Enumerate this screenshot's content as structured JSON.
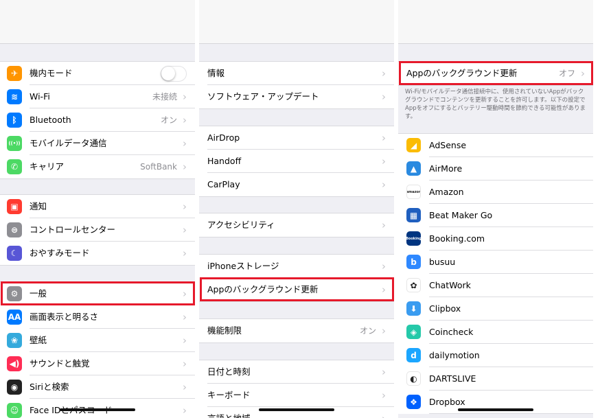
{
  "panel1": {
    "group1": [
      {
        "label": "機内モード",
        "icon": "airplane-icon",
        "color": "#ff9500",
        "glyph": "✈",
        "toggle": true
      },
      {
        "label": "Wi-Fi",
        "icon": "wifi-icon",
        "color": "#007aff",
        "glyph": "≋",
        "value": "未接続"
      },
      {
        "label": "Bluetooth",
        "icon": "bluetooth-icon",
        "color": "#007aff",
        "glyph": "ᛒ",
        "value": "オン"
      },
      {
        "label": "モバイルデータ通信",
        "icon": "antenna-icon",
        "color": "#4cd964",
        "glyph": "((•))"
      },
      {
        "label": "キャリア",
        "icon": "phone-icon",
        "color": "#4cd964",
        "glyph": "✆",
        "value": "SoftBank"
      }
    ],
    "group2": [
      {
        "label": "通知",
        "icon": "notifications-icon",
        "color": "#ff3b30",
        "glyph": "▣"
      },
      {
        "label": "コントロールセンター",
        "icon": "control-center-icon",
        "color": "#8e8e93",
        "glyph": "⊜"
      },
      {
        "label": "おやすみモード",
        "icon": "moon-icon",
        "color": "#5856d6",
        "glyph": "☾"
      }
    ],
    "group3": [
      {
        "label": "一般",
        "icon": "gear-icon",
        "color": "#8e8e93",
        "glyph": "⚙"
      },
      {
        "label": "画面表示と明るさ",
        "icon": "display-icon",
        "color": "#007aff",
        "glyph": "AA"
      },
      {
        "label": "壁紙",
        "icon": "wallpaper-icon",
        "color": "#34aadc",
        "glyph": "❀"
      },
      {
        "label": "サウンドと触覚",
        "icon": "sound-icon",
        "color": "#ff2d55",
        "glyph": "◀)"
      },
      {
        "label": "Siriと検索",
        "icon": "siri-icon",
        "color": "#222222",
        "glyph": "◉"
      },
      {
        "label": "Face IDとパスコード",
        "icon": "faceid-icon",
        "color": "#4cd964",
        "glyph": "☺"
      }
    ]
  },
  "panel2": {
    "group1": [
      "情報",
      "ソフトウェア・アップデート"
    ],
    "group2": [
      "AirDrop",
      "Handoff",
      "CarPlay"
    ],
    "group3": [
      "アクセシビリティ"
    ],
    "group4": [
      "iPhoneストレージ",
      "Appのバックグラウンド更新"
    ],
    "group5": [
      {
        "label": "機能制限",
        "value": "オン"
      }
    ],
    "group6": [
      "日付と時刻",
      "キーボード",
      "言語と地域"
    ]
  },
  "panel3": {
    "header_row": {
      "label": "Appのバックグラウンド更新",
      "value": "オフ"
    },
    "note": "Wi-Fi/モバイルデータ通信接続中に、使用されていないAppがバックグラウンドでコンテンツを更新することを許可します。以下の設定でAppをオフにするとバッテリー駆動時間を節約できる可能性があります。",
    "apps": [
      {
        "label": "AdSense",
        "icon": "adsense-icon",
        "color": "#fbbc04",
        "glyph": "◢"
      },
      {
        "label": "AirMore",
        "icon": "airmore-icon",
        "color": "#2a8ae0",
        "glyph": "▲"
      },
      {
        "label": "Amazon",
        "icon": "amazon-icon",
        "color": "#ffffff",
        "glyph": "amazon"
      },
      {
        "label": "Beat Maker Go",
        "icon": "beatmaker-icon",
        "color": "#1f5fbf",
        "glyph": "▦"
      },
      {
        "label": "Booking.com",
        "icon": "booking-icon",
        "color": "#003580",
        "glyph": "Booking"
      },
      {
        "label": "busuu",
        "icon": "busuu-icon",
        "color": "#2e88ff",
        "glyph": "b"
      },
      {
        "label": "ChatWork",
        "icon": "chatwork-icon",
        "color": "#ffffff",
        "glyph": "✿"
      },
      {
        "label": "Clipbox",
        "icon": "clipbox-icon",
        "color": "#3a9cf0",
        "glyph": "⬇"
      },
      {
        "label": "Coincheck",
        "icon": "coincheck-icon",
        "color": "#25c9a9",
        "glyph": "◈"
      },
      {
        "label": "dailymotion",
        "icon": "dailymotion-icon",
        "color": "#1ba6ff",
        "glyph": "d"
      },
      {
        "label": "DARTSLIVE",
        "icon": "dartslive-icon",
        "color": "#ffffff",
        "glyph": "◐"
      },
      {
        "label": "Dropbox",
        "icon": "dropbox-icon",
        "color": "#0061fe",
        "glyph": "❖"
      }
    ]
  }
}
